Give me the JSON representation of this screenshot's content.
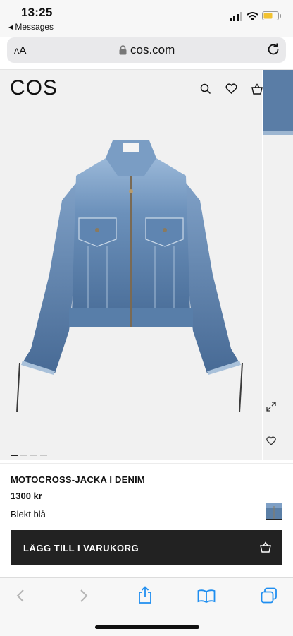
{
  "status_bar": {
    "time": "13:25",
    "back_app": "◂ Messages",
    "signal_icon": "signal-icon",
    "wifi_icon": "wifi-icon",
    "battery_icon": "battery-icon"
  },
  "browser": {
    "text_size_label_small": "A",
    "text_size_label_large": "A",
    "domain": "cos.com",
    "lock_icon": "lock-icon",
    "reload_icon": "reload-icon"
  },
  "site_header": {
    "logo": "COS",
    "icons": [
      "search-icon",
      "heart-icon",
      "bag-icon"
    ]
  },
  "product": {
    "title": "MOTOCROSS-JACKA I DENIM",
    "price": "1300 kr",
    "color_name": "Blekt blå",
    "add_to_cart_label": "LÄGG TILL I VARUKORG",
    "gallery_count": 4,
    "gallery_active_index": 0
  },
  "colors": {
    "denim_light": "#8fb0d4",
    "denim_mid": "#5e84b0",
    "denim_dark": "#3f6490",
    "button_bg": "#222222",
    "page_bg": "#ffffff",
    "gallery_bg": "#f1f1f1"
  },
  "toolbar": {
    "icons": [
      "back-icon",
      "forward-icon",
      "share-icon",
      "bookmarks-icon",
      "tabs-icon"
    ]
  }
}
